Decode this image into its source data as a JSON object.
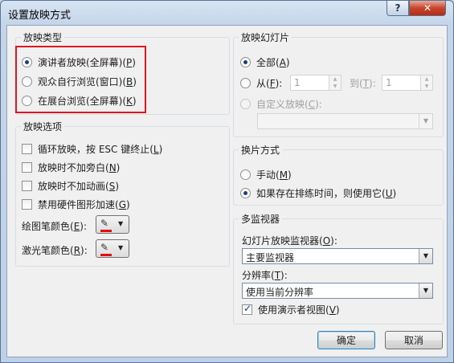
{
  "window": {
    "title": "设置放映方式"
  },
  "titlebar": {
    "help": "?",
    "close": "✕"
  },
  "show_type": {
    "title": "放映类型",
    "options": [
      {
        "label": "演讲者放映(全屏幕)(",
        "key": "P",
        "tail": ")",
        "selected": true
      },
      {
        "label": "观众自行浏览(窗口)(",
        "key": "B",
        "tail": ")",
        "selected": false
      },
      {
        "label": "在展台浏览(全屏幕)(",
        "key": "K",
        "tail": ")",
        "selected": false
      }
    ]
  },
  "show_options": {
    "title": "放映选项",
    "checks": [
      {
        "label": "循环放映，按 ESC 键终止(",
        "key": "L",
        "tail": ")",
        "checked": false
      },
      {
        "label": "放映时不加旁白(",
        "key": "N",
        "tail": ")",
        "checked": false
      },
      {
        "label": "放映时不加动画(",
        "key": "S",
        "tail": ")",
        "checked": false
      },
      {
        "label": "禁用硬件图形加速(",
        "key": "G",
        "tail": ")",
        "checked": false
      }
    ],
    "pen_color": {
      "label": "绘图笔颜色(",
      "key": "E",
      "tail": "):",
      "color": "#e01010"
    },
    "laser_color": {
      "label": "激光笔颜色(",
      "key": "R",
      "tail": "):",
      "color": "#e01010"
    }
  },
  "show_slides": {
    "title": "放映幻灯片",
    "all": {
      "label": "全部(",
      "key": "A",
      "tail": ")",
      "selected": true
    },
    "from": {
      "label": "从(",
      "key": "F",
      "tail": "):",
      "value": "1"
    },
    "to": {
      "label": "到(",
      "key": "T",
      "tail": "):",
      "value": "1"
    },
    "custom": {
      "label": "自定义放映(",
      "key": "C",
      "tail": "):",
      "value": ""
    }
  },
  "advance": {
    "title": "换片方式",
    "manual": {
      "label": "手动(",
      "key": "M",
      "tail": ")",
      "selected": false
    },
    "timings": {
      "label": "如果存在排练时间，则使用它(",
      "key": "U",
      "tail": ")",
      "selected": true
    }
  },
  "monitors": {
    "title": "多监视器",
    "monitor_label": {
      "label": "幻灯片放映监视器(",
      "key": "O",
      "tail": "):"
    },
    "monitor_value": "主要监视器",
    "resolution_label": {
      "label": "分辨率(",
      "key": "T",
      "tail": "):"
    },
    "resolution_value": "使用当前分辨率",
    "presenter_view": {
      "label": "使用演示者视图(",
      "key": "V",
      "tail": ")",
      "checked": true
    }
  },
  "buttons": {
    "ok": "确定",
    "cancel": "取消"
  }
}
